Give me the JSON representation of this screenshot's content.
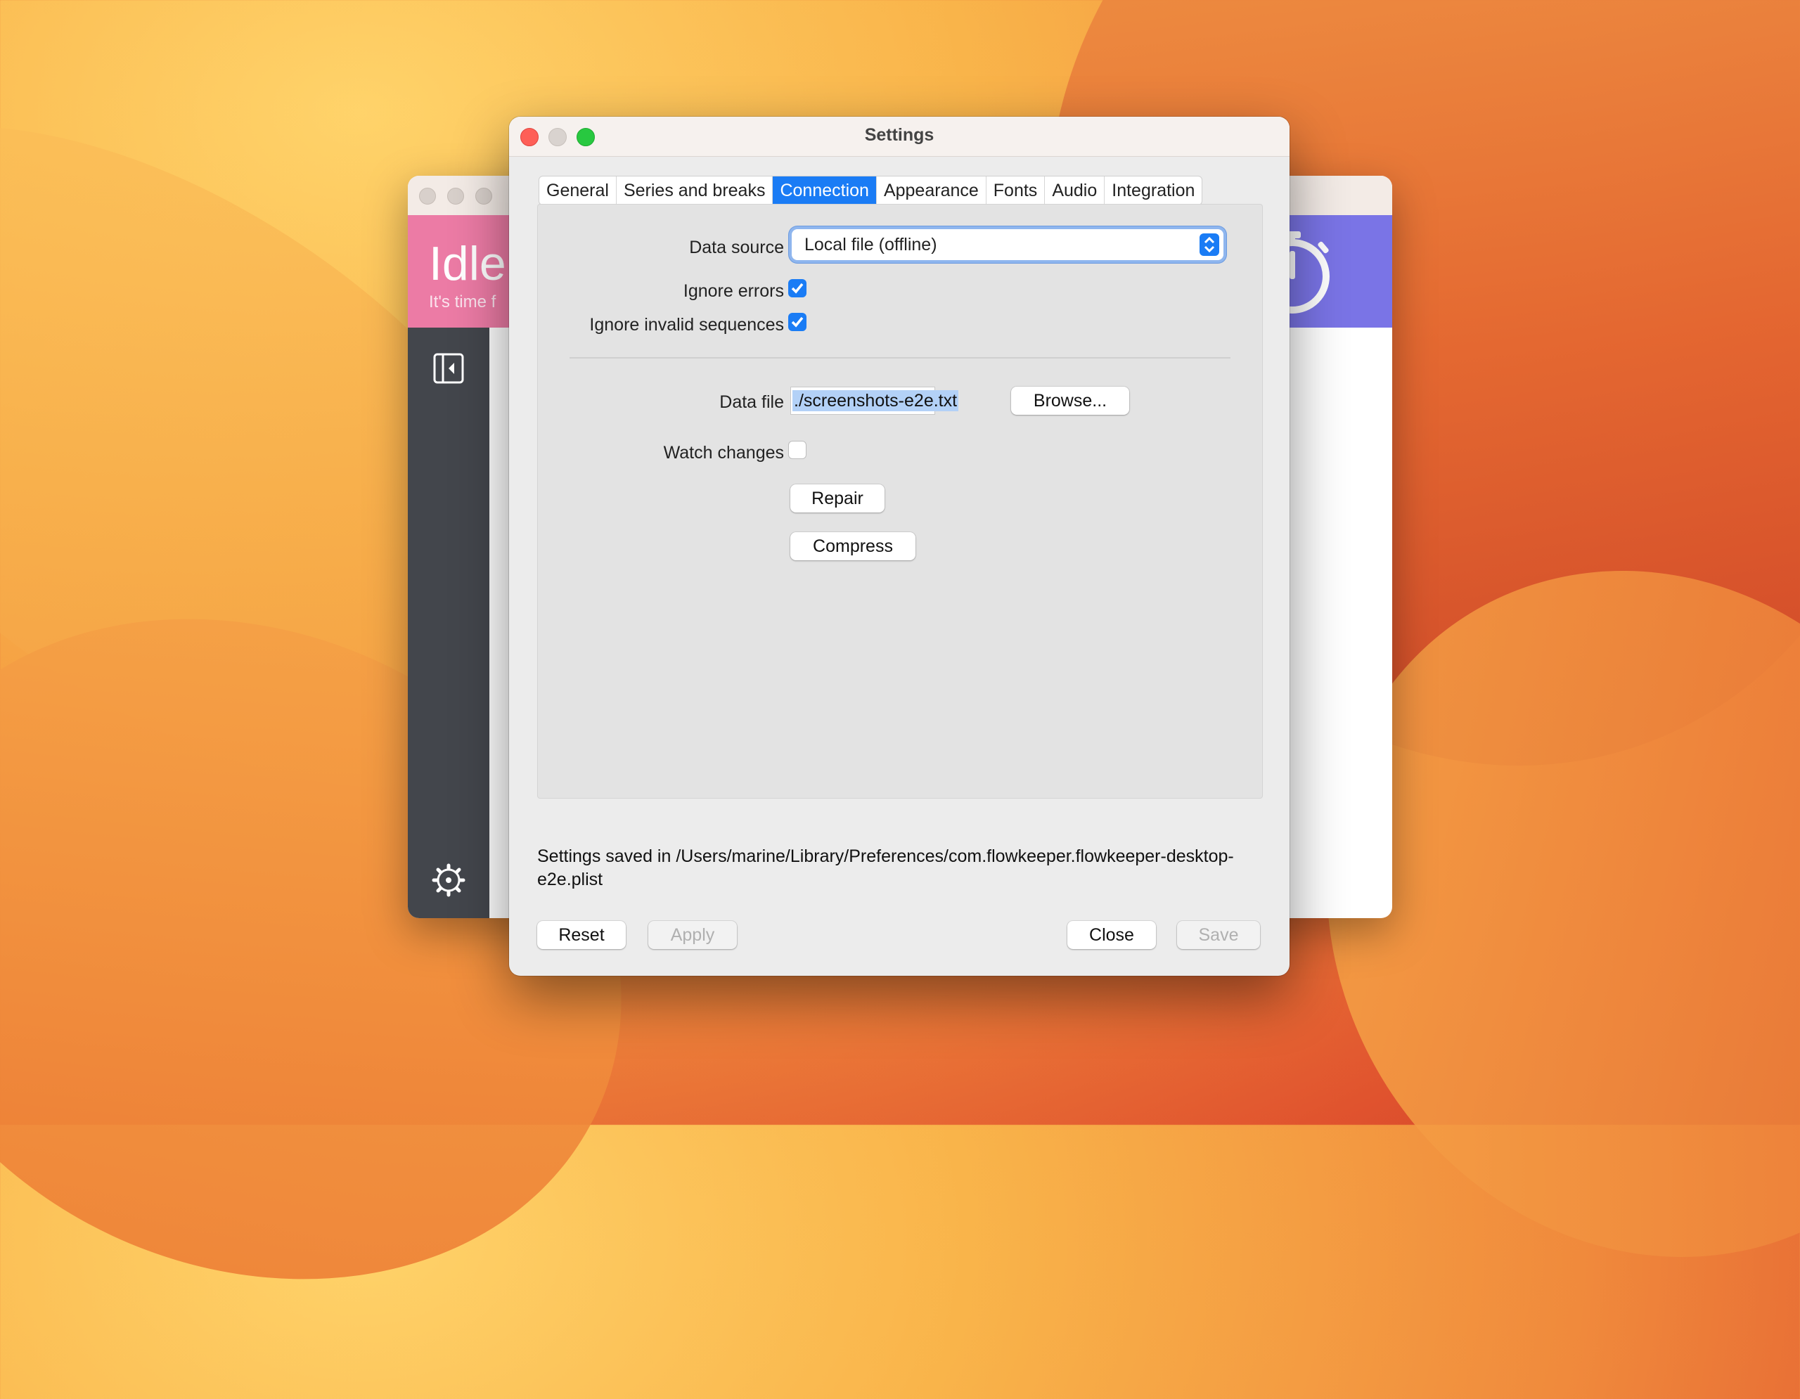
{
  "main_window": {
    "status_title": "Idle",
    "status_subtitle": "It's time f"
  },
  "dialog": {
    "title": "Settings",
    "tabs": [
      {
        "label": "General",
        "active": false
      },
      {
        "label": "Series and breaks",
        "active": false
      },
      {
        "label": "Connection",
        "active": true
      },
      {
        "label": "Appearance",
        "active": false
      },
      {
        "label": "Fonts",
        "active": false
      },
      {
        "label": "Audio",
        "active": false
      },
      {
        "label": "Integration",
        "active": false
      }
    ],
    "connection": {
      "data_source_label": "Data source",
      "data_source_value": "Local file (offline)",
      "ignore_errors_label": "Ignore errors",
      "ignore_errors_checked": true,
      "ignore_invalid_label": "Ignore invalid sequences",
      "ignore_invalid_checked": true,
      "data_file_label": "Data file",
      "data_file_value": "./screenshots-e2e.txt",
      "browse_label": "Browse...",
      "watch_changes_label": "Watch changes",
      "watch_changes_checked": false,
      "repair_label": "Repair",
      "compress_label": "Compress"
    },
    "saved_message": "Settings saved in /Users/marine/Library/Preferences/com.flowkeeper.flowkeeper-desktop-e2e.plist",
    "buttons": {
      "reset": "Reset",
      "apply": "Apply",
      "close": "Close",
      "save": "Save"
    }
  },
  "colors": {
    "accent": "#1a7cf5",
    "idle_header": "#ec7ba5",
    "timer_header": "#7a74e6",
    "sidebar": "#43464c"
  }
}
